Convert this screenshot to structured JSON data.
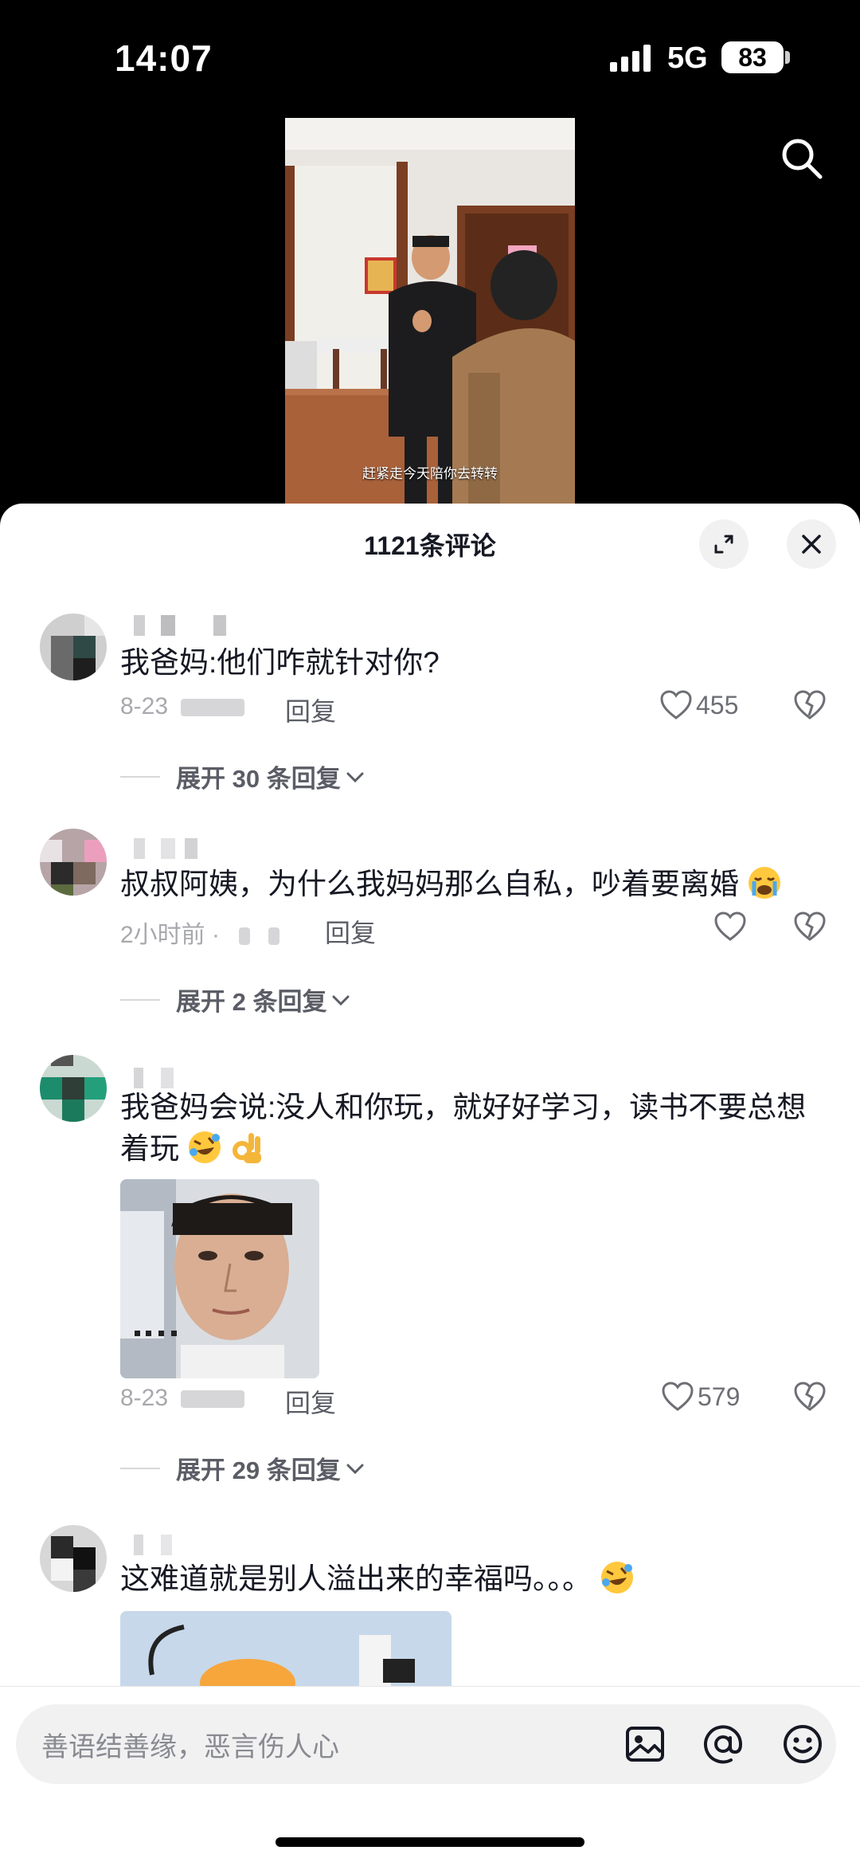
{
  "status_bar": {
    "time": "14:07",
    "network": "5G",
    "battery": "83"
  },
  "video": {
    "subtitle": "赶紧走今天陪你去转转"
  },
  "sheet": {
    "title": "1121条评论"
  },
  "comments": [
    {
      "text": "我爸妈:他们咋就针对你?",
      "date": "8-23",
      "reply_label": "回复",
      "likes": "455",
      "expand_label": "展开 30 条回复"
    },
    {
      "text": "叔叔阿姨，为什么我妈妈那么自私，吵着要离婚",
      "date": "2小时前 ·",
      "reply_label": "回复",
      "likes": "",
      "expand_label": "展开 2 条回复"
    },
    {
      "text_line1": "我爸妈会说:没人和你玩，就好好学习，读书不要总想",
      "text_line2": "着玩",
      "date": "8-23",
      "reply_label": "回复",
      "likes": "579",
      "expand_label": "展开 29 条回复"
    },
    {
      "text": "这难道就是别人溢出来的幸福吗。。。"
    }
  ],
  "input": {
    "placeholder": "善语结善缘，恶言伤人心"
  },
  "icons": [
    "search-icon",
    "expand-icon",
    "close-icon",
    "heart-icon",
    "broken-heart-icon",
    "chevron-down-icon",
    "image-icon",
    "at-icon",
    "smile-icon"
  ]
}
